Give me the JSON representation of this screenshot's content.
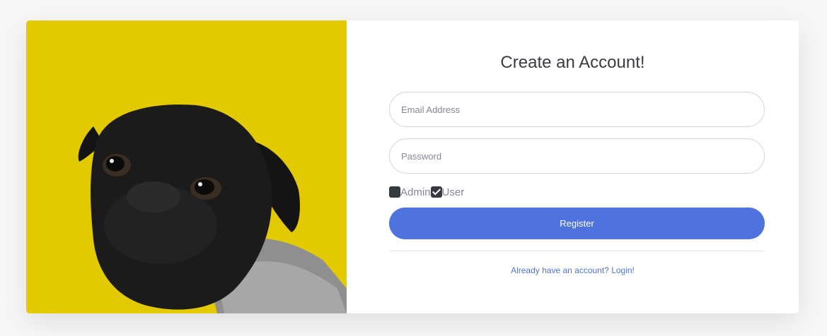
{
  "form": {
    "title": "Create an Account!",
    "email_placeholder": "Email Address",
    "password_placeholder": "Password",
    "roles": [
      {
        "label": "Admin",
        "checked": false
      },
      {
        "label": "User",
        "checked": true
      }
    ],
    "register_label": "Register",
    "login_link": "Already have an account? Login!"
  },
  "colors": {
    "primary": "#4e73df",
    "image_background": "#e3c900",
    "title_text": "#3a3b45"
  },
  "image": {
    "subject": "black pug wearing a knit sweater on yellow background"
  }
}
